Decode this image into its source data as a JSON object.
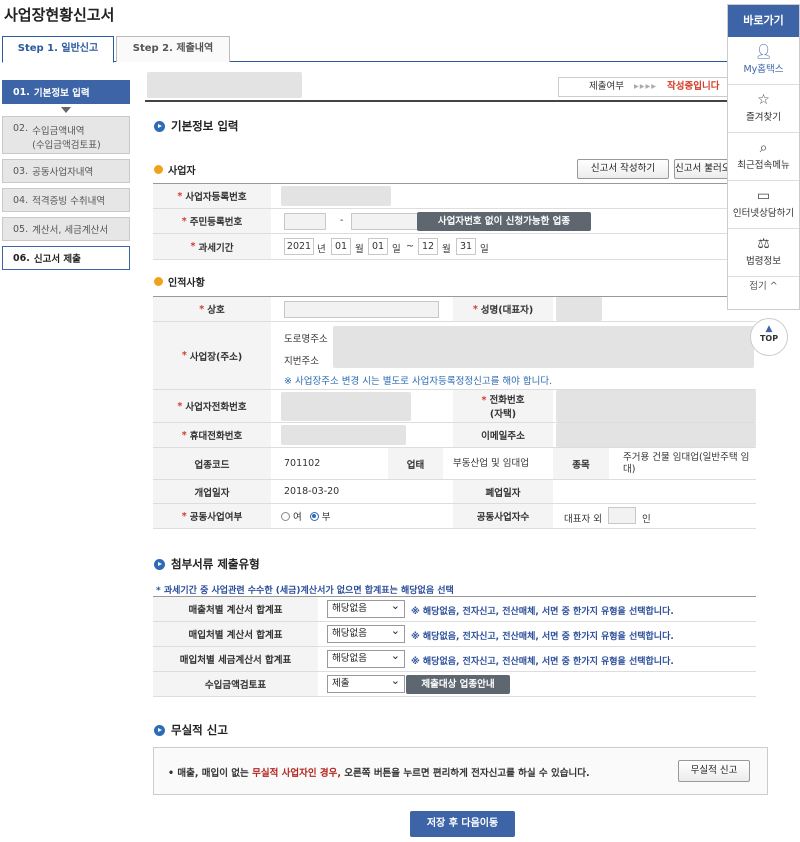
{
  "page_title": "사업장현황신고서",
  "tabs": [
    {
      "label": "Step 1. 일반신고"
    },
    {
      "label": "Step 2. 제출내역"
    }
  ],
  "left_nav": [
    {
      "num": "01.",
      "label": "기본정보 입력"
    },
    {
      "num": "02.",
      "label": "수입금액내역",
      "label2": "(수입금액검토표)"
    },
    {
      "num": "03.",
      "label": "공동사업자내역"
    },
    {
      "num": "04.",
      "label": "적격증빙 수취내역"
    },
    {
      "num": "05.",
      "label": "계산서, 세금계산서"
    },
    {
      "num": "06.",
      "label": "신고서 제출"
    }
  ],
  "status": {
    "label": "제출여부",
    "arrows": "▸▸▸▸",
    "current": "작성중입니다"
  },
  "basic": {
    "title": "기본정보 입력",
    "business_head": "사업자",
    "write_btn": "신고서 작성하기",
    "fetch_btn": "신고서 불러오기",
    "biz_no_label": "사업자등록번호",
    "resident_no_label": "주민등록번호",
    "resident_dash": "-",
    "no_biz_btn": "사업자번호 없이 신청가능한 업종",
    "period_label": "과세기간",
    "period": {
      "y1": "2021",
      "y_unit": "년",
      "m1": "01",
      "m_unit": "월",
      "d1": "01",
      "d_unit": "일",
      "tilde": "~",
      "m2": "12",
      "d2": "31"
    }
  },
  "personal": {
    "head": "인적사항",
    "trade_name": "상호",
    "rep_name": "성명(대표자)",
    "address": "사업장(주소)",
    "road_addr": "도로명주소",
    "lot_addr": "지번주소",
    "addr_note": "※ 사업장주소 변경 시는 별도로 사업자등록정정신고를 해야 합니다.",
    "biz_phone": "사업자전화번호",
    "home_phone_1": "전화번호",
    "home_phone_2": "(자택)",
    "mobile": "휴대전화번호",
    "email": "이메일주소",
    "industry_code_label": "업종코드",
    "industry_code": "701102",
    "biz_type_label": "업태",
    "biz_type": "부동산업 및 임대업",
    "item_label": "종목",
    "item": "주거용 건물 임대업(일반주택 임대)",
    "open_date_label": "개업일자",
    "open_date": "2018-03-20",
    "close_date_label": "폐업일자",
    "joint_label": "공동사업여부",
    "joint_yes": "여",
    "joint_no": "부",
    "joint_count_label": "공동사업자수",
    "rep_extra": "대표자 외",
    "persons": "인"
  },
  "attach": {
    "title": "첨부서류 제출유형",
    "note": "* 과세기간 중 사업관련 수수한 (세금)계산서가 없으면 합계표는 해당없음 선택",
    "rows": [
      {
        "label": "매출처별 계산서 합계표",
        "value": "해당없음",
        "hint": "※ 해당없음, 전자신고, 전산매체, 서면 중 한가지 유형을 선택합니다."
      },
      {
        "label": "매입처별 계산서 합계표",
        "value": "해당없음",
        "hint": "※ 해당없음, 전자신고, 전산매체, 서면 중 한가지 유형을 선택합니다."
      },
      {
        "label": "매입처별 세금계산서 합계표",
        "value": "해당없음",
        "hint": "※ 해당없음, 전자신고, 전산매체, 서면 중 한가지 유형을 선택합니다."
      },
      {
        "label": "수입금액검토표",
        "value": "제출",
        "hint": ""
      }
    ],
    "guide_btn": "제출대상 업종안내"
  },
  "nil": {
    "title": "무실적 신고",
    "msg_a": "• 매출, 매입이 없는 ",
    "msg_b": "무실적 사업자인 경우,",
    "msg_c": " 오른쪽 버튼을 누르면 편리하게 전자신고를 하실 수 있습니다.",
    "btn": "무실적 신고"
  },
  "save_btn": "저장 후 다음이동",
  "quick": {
    "head": "바로가기",
    "items": [
      "My홈택스",
      "즐겨찾기",
      "최근접속메뉴",
      "인터넷상담하기",
      "법령정보"
    ],
    "fold": "접기 ^",
    "top": "TOP"
  }
}
